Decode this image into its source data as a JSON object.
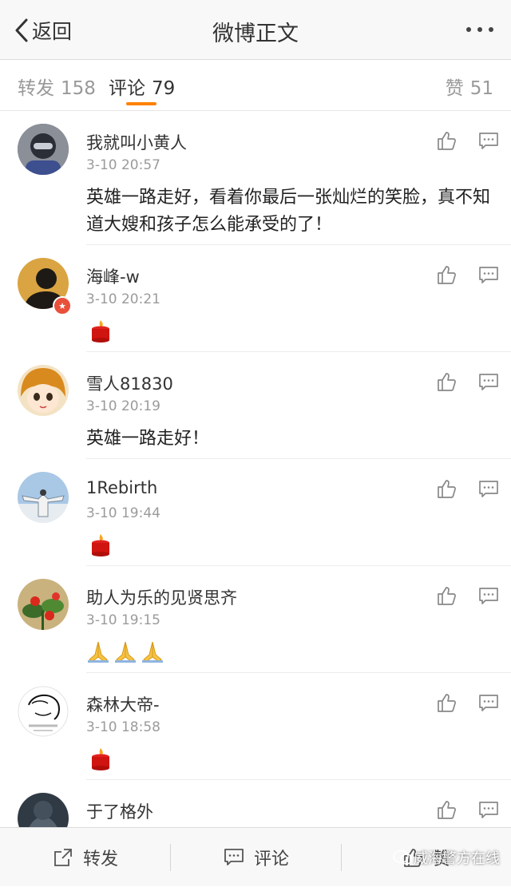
{
  "nav": {
    "back_label": "返回",
    "title": "微博正文"
  },
  "tabs": {
    "repost": {
      "label": "转发",
      "count": "158"
    },
    "comments": {
      "label": "评论",
      "count": "79"
    },
    "likes": {
      "label": "赞",
      "count": "51"
    }
  },
  "colors": {
    "accent": "#ff8200"
  },
  "comments": [
    {
      "user": "我就叫小黄人",
      "time": "3-10 20:57",
      "text": "英雄一路走好，看着你最后一张灿烂的笑脸，真不知道大嫂和孩子怎么能承受的了！"
    },
    {
      "user": "海峰-w",
      "time": "3-10 20:21",
      "emoji": [
        "candle"
      ]
    },
    {
      "user": "雪人81830",
      "time": "3-10 20:19",
      "text": "英雄一路走好！"
    },
    {
      "user": "1Rebirth",
      "time": "3-10 19:44",
      "emoji": [
        "candle"
      ]
    },
    {
      "user": "助人为乐的见贤思齐",
      "time": "3-10 19:15",
      "emoji": [
        "pray",
        "pray",
        "pray"
      ]
    },
    {
      "user": "森林大帝-",
      "time": "3-10 18:58",
      "emoji": [
        "candle"
      ]
    },
    {
      "user": "于了格外"
    }
  ],
  "bottom": {
    "repost": "转发",
    "comment": "评论",
    "like": "赞"
  },
  "watermark": "威海警方在线"
}
